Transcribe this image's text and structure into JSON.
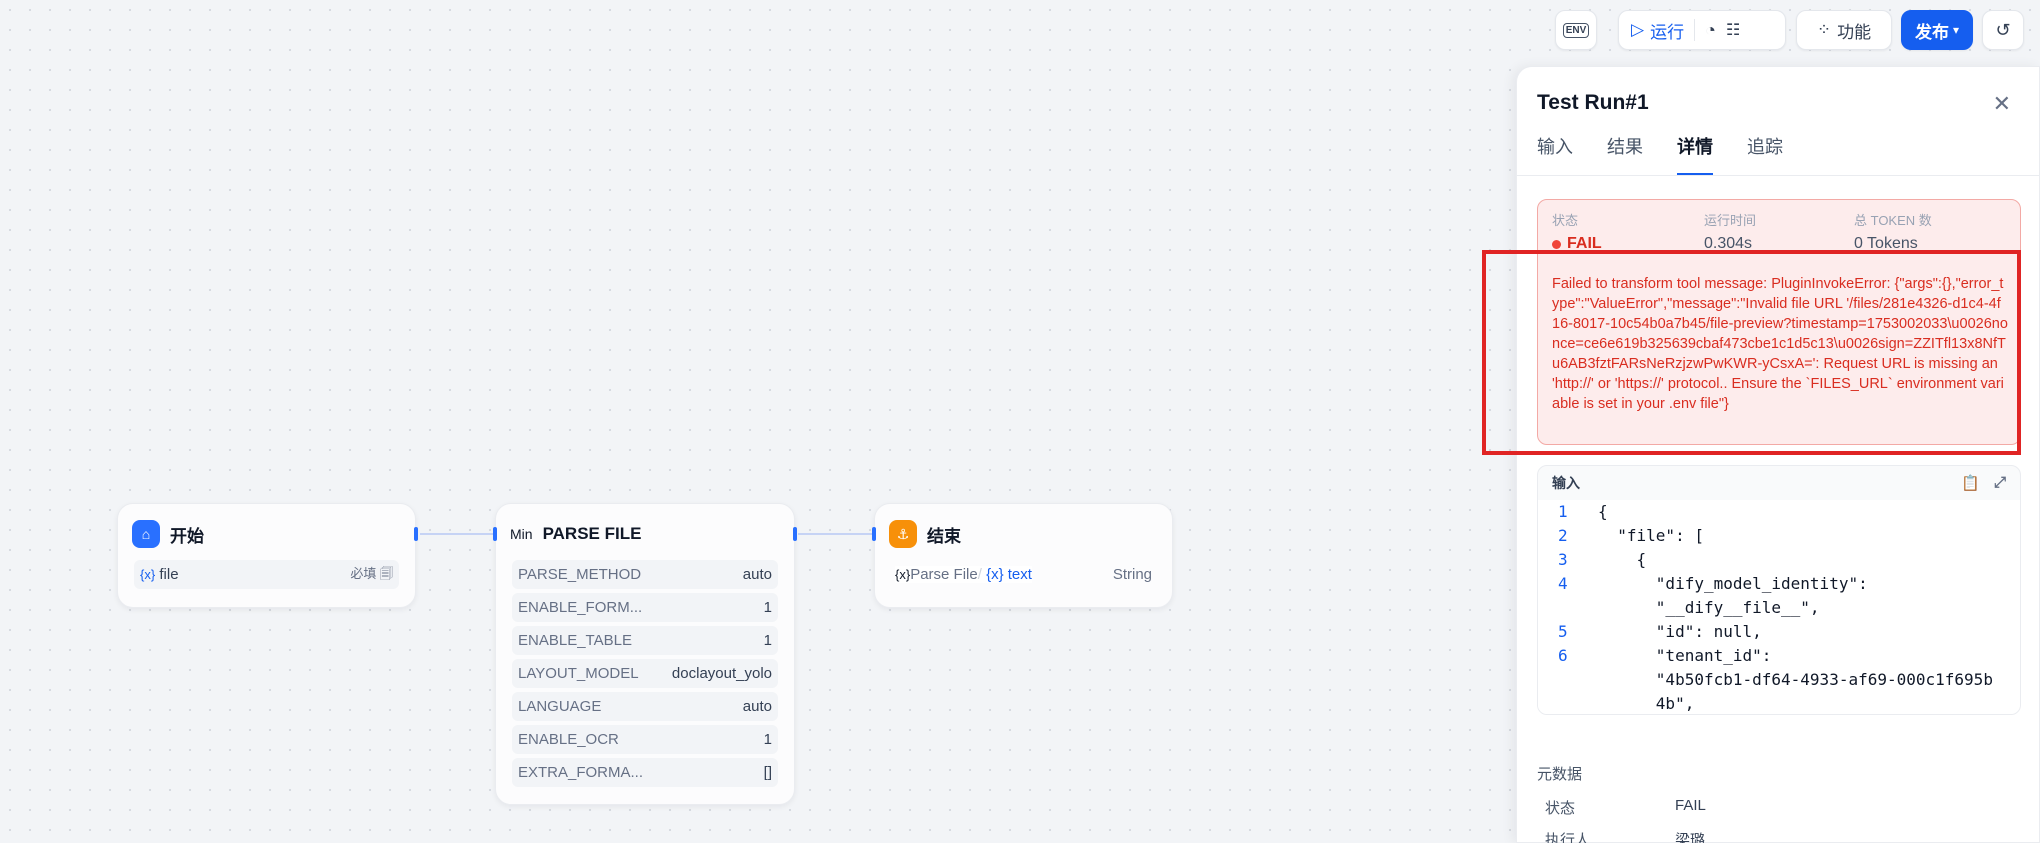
{
  "toolbar": {
    "env_label": "ENV",
    "run_label": "运行",
    "features_label": "功能",
    "publish_label": "发布"
  },
  "nodes": {
    "start": {
      "title": "开始",
      "var_prefix": "{x}",
      "var_name": "file",
      "required_label": "必填"
    },
    "parse": {
      "icon_text": "Min",
      "title": "PARSE FILE",
      "params": [
        {
          "key": "PARSE_METHOD",
          "value": "auto"
        },
        {
          "key": "ENABLE_FORM...",
          "value": "1"
        },
        {
          "key": "ENABLE_TABLE",
          "value": "1"
        },
        {
          "key": "LAYOUT_MODEL",
          "value": "doclayout_yolo"
        },
        {
          "key": "LANGUAGE",
          "value": "auto"
        },
        {
          "key": "ENABLE_OCR",
          "value": "1"
        },
        {
          "key": "EXTRA_FORMA...",
          "value": "[]"
        }
      ]
    },
    "end": {
      "title": "结束",
      "var_prefix": "{x}",
      "source_node": "Parse File",
      "separator": "/",
      "var_name": "{x} text",
      "type": "String"
    }
  },
  "panel": {
    "title": "Test Run#1",
    "tabs": [
      "输入",
      "结果",
      "详情",
      "追踪"
    ],
    "active_tab": "详情",
    "status": {
      "status_label": "状态",
      "status_value": "FAIL",
      "time_label": "运行时间",
      "time_value": "0.304s",
      "tokens_label": "总 TOKEN 数",
      "tokens_value": "0 Tokens"
    },
    "error_message": "Failed to transform tool message: PluginInvokeError: {\"args\":{},\"error_type\":\"ValueError\",\"message\":\"Invalid file URL '/files/281e4326-d1c4-4f16-8017-10c54b0a7b45/file-preview?timestamp=1753002033\\u0026nonce=ce6e619b325639cbaf473cbe1c1d5c13\\u0026sign=ZZITfl13x8NfTu6AB3fztFARsNeRzjzwPwKWR-yCsxA=': Request URL is missing an 'http://' or 'https://' protocol.. Ensure the `FILES_URL` environment variable is set in your .env file\"}",
    "input_label": "输入",
    "code_lines": [
      {
        "n": "1",
        "text": "{"
      },
      {
        "n": "2",
        "text": "  \"file\": ["
      },
      {
        "n": "3",
        "text": "    {"
      },
      {
        "n": "4",
        "text": "      \"dify_model_identity\":"
      },
      {
        "n": "",
        "text": "      \"__dify__file__\","
      },
      {
        "n": "5",
        "text": "      \"id\": null,"
      },
      {
        "n": "6",
        "text": "      \"tenant_id\":"
      },
      {
        "n": "",
        "text": "      \"4b50fcb1-df64-4933-af69-000c1f695b"
      },
      {
        "n": "",
        "text": "      4b\","
      }
    ],
    "metadata_label": "元数据",
    "metadata": [
      {
        "key": "状态",
        "value": "FAIL"
      },
      {
        "key": "执行人",
        "value": "梁璐"
      }
    ]
  },
  "colors": {
    "accent": "#155eef",
    "fail": "#d92d20",
    "start_icon": "#2970ff",
    "end_icon": "#f79009"
  }
}
